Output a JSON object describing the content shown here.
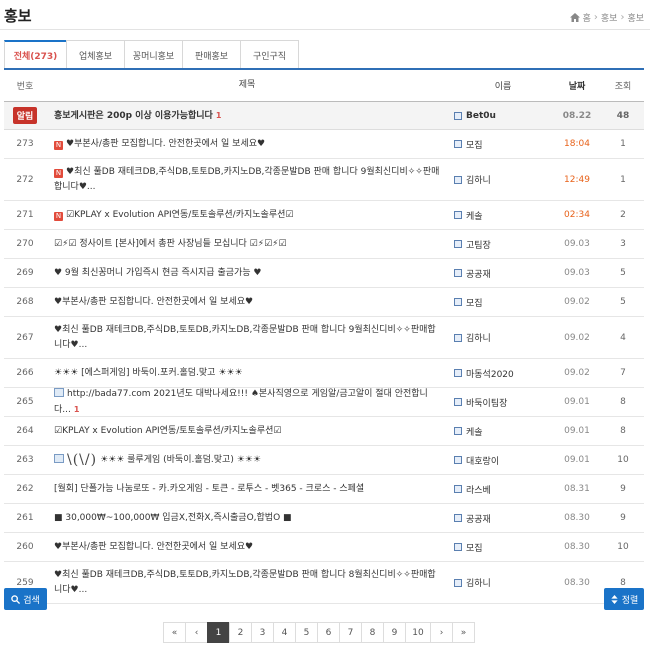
{
  "page": {
    "title": "홍보",
    "breadcrumb": [
      "홈",
      "홍보",
      "홍보"
    ]
  },
  "tabs": [
    {
      "label": "전체(273)",
      "active": true
    },
    {
      "label": "업체홍보",
      "active": false
    },
    {
      "label": "꽁머니홍보",
      "active": false
    },
    {
      "label": "판매홍보",
      "active": false
    },
    {
      "label": "구인구직",
      "active": false
    }
  ],
  "table": {
    "headers": {
      "num": "번호",
      "title": "제목",
      "name": "이름",
      "date": "날짜",
      "views": "조회"
    },
    "rows": [
      {
        "num": "알림",
        "notice": true,
        "icon": "",
        "title": "홍보게시판은 200p 이상 이용가능합니다",
        "comments": "1",
        "name": "Bet0u",
        "date": "08.22",
        "recent": false,
        "views": "48"
      },
      {
        "num": "273",
        "icon": "new",
        "title": "♥부본사/총판 모집합니다. 안전한곳에서 일 보세요♥",
        "comments": "",
        "name": "모집",
        "date": "18:04",
        "recent": true,
        "views": "1"
      },
      {
        "num": "272",
        "icon": "new",
        "title": "♥최신 풀DB 재테크DB,주식DB,토토DB,카지노DB,각종문발DB 판매 합니다 9월최신디비✧✧판매합니다♥...",
        "comments": "",
        "name": "김하니",
        "date": "12:49",
        "recent": true,
        "views": "1"
      },
      {
        "num": "271",
        "icon": "new",
        "title": "☑KPLAY x Evolution API연동/토토솔루션/카지노솔루션☑",
        "comments": "",
        "name": "케솔",
        "date": "02:34",
        "recent": true,
        "views": "2"
      },
      {
        "num": "270",
        "icon": "",
        "title": "☑⚡☑ 정사이트 [본사]에서 총판 사장님들 모십니다 ☑⚡☑⚡☑",
        "comments": "",
        "name": "고팀장",
        "date": "09.03",
        "recent": false,
        "views": "3"
      },
      {
        "num": "269",
        "icon": "",
        "title": "♥ 9월 최신꽁머니 가입즉시 현금 즉시지급 출금가능 ♥",
        "comments": "",
        "name": "공공재",
        "date": "09.03",
        "recent": false,
        "views": "5"
      },
      {
        "num": "268",
        "icon": "",
        "title": "♥부본사/총판 모집합니다. 안전한곳에서 일 보세요♥",
        "comments": "",
        "name": "모집",
        "date": "09.02",
        "recent": false,
        "views": "5"
      },
      {
        "num": "267",
        "icon": "",
        "title": "♥최신 풀DB 재테크DB,주식DB,토토DB,카지노DB,각종문발DB 판매 합니다 9월최신디비✧✧판매합니다♥...",
        "comments": "",
        "name": "김하니",
        "date": "09.02",
        "recent": false,
        "views": "4"
      },
      {
        "num": "266",
        "icon": "",
        "title": "☀☀☀ [에스퍼게임] 바둑이.포커.홀덤.맞고 ☀☀☀",
        "comments": "",
        "name": "마동석2020",
        "date": "09.02",
        "recent": false,
        "views": "7"
      },
      {
        "num": "265",
        "icon": "img",
        "title": "http://bada77.com 2021년도 대박나세요!!! ♠본사직영으로 게임알/금고알이 절대 안전합니다...",
        "comments": "1",
        "name": "바둑이팀장",
        "date": "09.01",
        "recent": false,
        "views": "8"
      },
      {
        "num": "264",
        "icon": "",
        "title": "☑KPLAY x Evolution API연동/토토솔루션/카지노솔루션☑",
        "comments": "",
        "name": "케솔",
        "date": "09.01",
        "recent": false,
        "views": "8"
      },
      {
        "num": "263",
        "icon": "img",
        "deco": "\\(\\/)",
        "title": "☀☀☀ 룰루게임 (바둑이.홀덤.맞고) ☀☀☀",
        "comments": "",
        "name": "대호랑이",
        "date": "09.01",
        "recent": false,
        "views": "10"
      },
      {
        "num": "262",
        "icon": "",
        "title": "[월회] 단폴가능 나눔로또 - 카.카오게임 - 토큰 - 로투스 - 벳365 - 크로스 - 스페셜",
        "comments": "",
        "name": "라스베",
        "date": "08.31",
        "recent": false,
        "views": "9"
      },
      {
        "num": "261",
        "icon": "",
        "title": "■ 30,000₩~100,000₩ 입금X,전화X,즉시출금O,합법O ■",
        "comments": "",
        "name": "공공재",
        "date": "08.30",
        "recent": false,
        "views": "9"
      },
      {
        "num": "260",
        "icon": "",
        "title": "♥부본사/총판 모집합니다. 안전한곳에서 일 보세요♥",
        "comments": "",
        "name": "모집",
        "date": "08.30",
        "recent": false,
        "views": "10"
      },
      {
        "num": "259",
        "icon": "",
        "title": "♥최신 풀DB 재테크DB,주식DB,토토DB,카지노DB,각종문발DB 판매 합니다 8월최신디비✧✧판매합니다♥...",
        "comments": "",
        "name": "김하니",
        "date": "08.30",
        "recent": false,
        "views": "8"
      }
    ]
  },
  "buttons": {
    "search": "검색",
    "sort": "정렬"
  },
  "pagination": {
    "first": "«",
    "prev": "‹",
    "next": "›",
    "last": "»",
    "pages": [
      "1",
      "2",
      "3",
      "4",
      "5",
      "6",
      "7",
      "8",
      "9",
      "10"
    ],
    "current": "1"
  },
  "colors": {
    "accent": "#1a73c8",
    "notice": "#c7332a",
    "recent": "#e8621a",
    "active_tab": "#d9534f"
  }
}
